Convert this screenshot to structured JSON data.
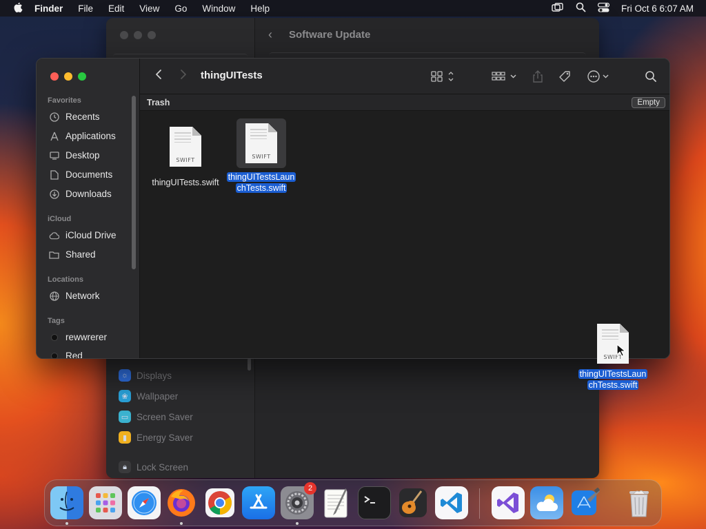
{
  "menubar": {
    "app_name": "Finder",
    "items": [
      "File",
      "Edit",
      "View",
      "Go",
      "Window",
      "Help"
    ],
    "clock": "Fri Oct 6  6:07 AM"
  },
  "settings_window": {
    "title": "Software Update",
    "sidebar_items": [
      {
        "label": "Displays",
        "icon": "displays-icon",
        "color": "#2f6fe0"
      },
      {
        "label": "Wallpaper",
        "icon": "wallpaper-icon",
        "color": "#2aa1d8"
      },
      {
        "label": "Screen Saver",
        "icon": "screen-saver-icon",
        "color": "#3bb2cf"
      },
      {
        "label": "Energy Saver",
        "icon": "energy-saver-icon",
        "color": "#f0b020"
      },
      {
        "label": "Lock Screen",
        "icon": "lock-icon",
        "color": "#3a3a3c"
      }
    ]
  },
  "finder": {
    "title": "thingUITests",
    "path_label": "Trash",
    "empty_button": "Empty",
    "sidebar": {
      "favorites_header": "Favorites",
      "favorites": [
        {
          "label": "Recents",
          "icon": "clock-icon"
        },
        {
          "label": "Applications",
          "icon": "applications-icon"
        },
        {
          "label": "Desktop",
          "icon": "desktop-icon"
        },
        {
          "label": "Documents",
          "icon": "document-icon"
        },
        {
          "label": "Downloads",
          "icon": "download-icon"
        }
      ],
      "icloud_header": "iCloud",
      "icloud": [
        {
          "label": "iCloud Drive",
          "icon": "cloud-icon"
        },
        {
          "label": "Shared",
          "icon": "shared-folder-icon"
        }
      ],
      "locations_header": "Locations",
      "locations": [
        {
          "label": "Network",
          "icon": "globe-icon"
        }
      ],
      "tags_header": "Tags",
      "tags": [
        {
          "label": "rewwrerer",
          "color": "#111111"
        },
        {
          "label": "Red",
          "color": "#111111"
        }
      ]
    },
    "files": [
      {
        "name_line1": "thingUITests.swift",
        "name_line2": "",
        "ext": "SWIFT",
        "selected": false
      },
      {
        "name_line1": "thingUITestsLaun",
        "name_line2": "chTests.swift",
        "ext": "SWIFT",
        "selected": true
      }
    ]
  },
  "dragged_file": {
    "name_line1": "thingUITestsLaun",
    "name_line2": "chTests.swift",
    "ext": "SWIFT"
  },
  "dock": {
    "apps": [
      {
        "name": "Finder",
        "icon": "finder-icon",
        "running": true
      },
      {
        "name": "Launchpad",
        "icon": "launchpad-icon",
        "running": false
      },
      {
        "name": "Safari",
        "icon": "safari-icon",
        "running": false
      },
      {
        "name": "Firefox",
        "icon": "firefox-icon",
        "running": true
      },
      {
        "name": "Chrome",
        "icon": "chrome-icon",
        "running": false
      },
      {
        "name": "App Store",
        "icon": "app-store-icon",
        "running": false
      },
      {
        "name": "System Settings",
        "icon": "settings-gear-icon",
        "running": true,
        "badge": "2"
      },
      {
        "name": "TextEdit",
        "icon": "textedit-icon",
        "running": false
      },
      {
        "name": "Terminal",
        "icon": "terminal-icon",
        "running": false
      },
      {
        "name": "GarageBand",
        "icon": "guitar-icon",
        "running": false
      },
      {
        "name": "Visual Studio Code",
        "icon": "vscode-icon",
        "running": false
      },
      {
        "name": "Visual Studio",
        "icon": "visual-studio-icon",
        "running": false
      },
      {
        "name": "Weather",
        "icon": "weather-icon",
        "running": false
      },
      {
        "name": "Xcode",
        "icon": "xcode-icon",
        "running": false
      },
      {
        "name": "Trash",
        "icon": "trash-icon",
        "running": false
      }
    ]
  }
}
